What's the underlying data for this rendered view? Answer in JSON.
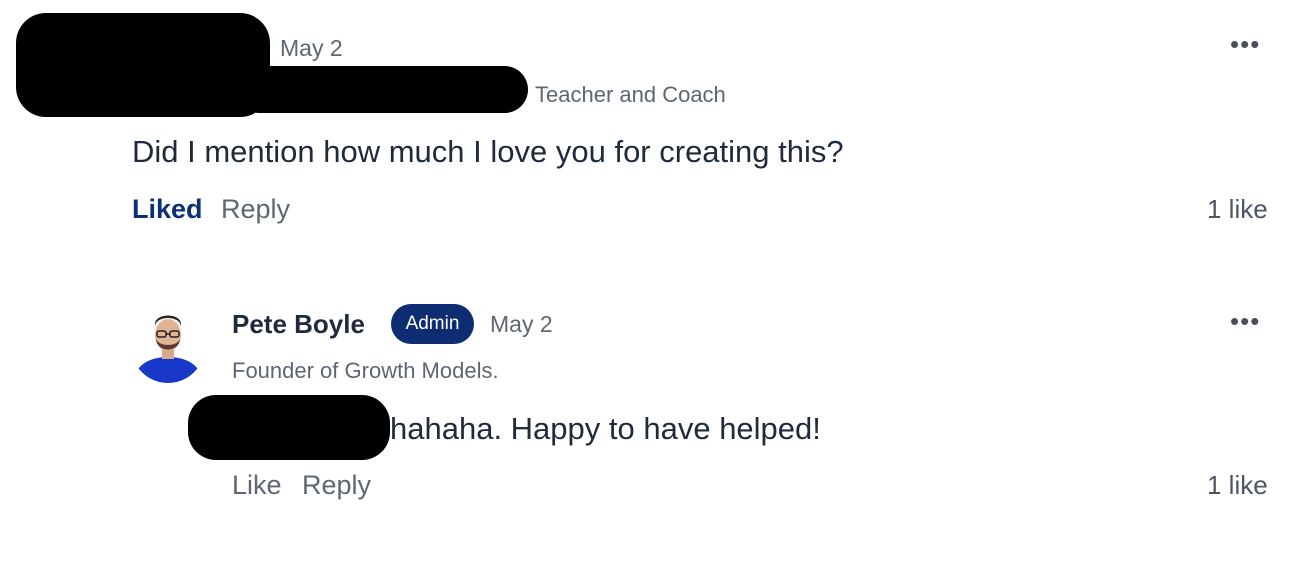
{
  "comment": {
    "date": "May 2",
    "subtitle": "Teacher and Coach",
    "body": "Did I mention how much I love you for creating this?",
    "actions": {
      "like_label": "Liked",
      "reply_label": "Reply"
    },
    "like_count": "1 like",
    "more_icon": "more-horizontal-icon"
  },
  "reply": {
    "author": "Pete Boyle",
    "badge": "Admin",
    "date": "May 2",
    "subtitle": "Founder of Growth Models.",
    "body": "hahaha. Happy to have helped!",
    "actions": {
      "like_label": "Like",
      "reply_label": "Reply"
    },
    "like_count": "1 like",
    "more_icon": "more-horizontal-icon"
  },
  "colors": {
    "accent": "#0e2c72",
    "liked": "#0b2f7a",
    "text": "#1f2a3d",
    "muted": "#5f6673"
  }
}
